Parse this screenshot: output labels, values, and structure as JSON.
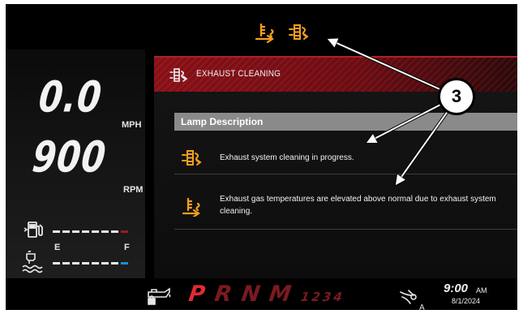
{
  "colors": {
    "lamp_amber": "#f59f1e",
    "header_red": "#8a0f16",
    "gear_active": "#e02b34",
    "gear_inactive": "#7a1a20"
  },
  "top_lamps": [
    "exhaust-temperature-lamp-icon",
    "exhaust-cleaning-lamp-icon"
  ],
  "gauges": {
    "speed_value": "0.0",
    "speed_unit": "MPH",
    "rpm_value": "900",
    "rpm_unit": "RPM",
    "fuel_level_fraction": 0.875,
    "def_level_fraction": 0.875,
    "empty_label": "E",
    "full_label": "F"
  },
  "header": {
    "icon": "exhaust-cleaning-icon",
    "title": "EXHAUST CLEANING"
  },
  "lamp_description": {
    "heading": "Lamp Description",
    "rows": [
      {
        "icon": "exhaust-cleaning-icon",
        "text": "Exhaust system cleaning in progress."
      },
      {
        "icon": "exhaust-temperature-icon",
        "text": "Exhaust gas temperatures are elevated above normal due to exhaust system cleaning."
      }
    ]
  },
  "bottom_bar": {
    "gears": {
      "p": "P",
      "r": "R",
      "n": "N",
      "m": "M",
      "numbers": "1234"
    },
    "selected_gear": "P",
    "steering_mode": "A",
    "clock_time": "9:00",
    "clock_ampm": "AM",
    "date": "8/1/2024"
  },
  "callout": {
    "number": "3"
  }
}
